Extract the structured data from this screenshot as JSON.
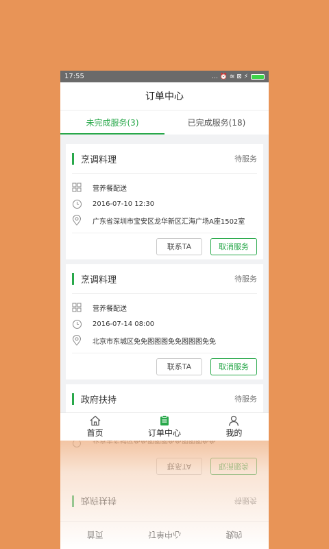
{
  "status_bar": {
    "time": "17:55",
    "icons": "… ⏰ ≋ ⊠ ⚡"
  },
  "header": {
    "title": "订单中心"
  },
  "tabs": [
    {
      "label": "未完成服务(3)",
      "active": true
    },
    {
      "label": "已完成服务(18)",
      "active": false
    }
  ],
  "orders": [
    {
      "name": "烹调料理",
      "status": "待服务",
      "service": "营养餐配送",
      "time": "2016-07-10 12:30",
      "address": "广东省深圳市宝安区龙华新区汇海广场A座1502室",
      "contact_label": "联系TA",
      "cancel_label": "取消服务"
    },
    {
      "name": "烹调料理",
      "status": "待服务",
      "service": "营养餐配送",
      "time": "2016-07-14 08:00",
      "address": "北京市东城区免免图图图免免图图图免免",
      "contact_label": "联系TA",
      "cancel_label": "取消服务"
    },
    {
      "name": "政府扶持",
      "status": "待服务"
    }
  ],
  "bottom_nav": [
    {
      "label": "首页",
      "icon": "home-icon",
      "active": false
    },
    {
      "label": "订单中心",
      "icon": "order-icon",
      "active": true
    },
    {
      "label": "我的",
      "icon": "profile-icon",
      "active": false
    }
  ],
  "colors": {
    "accent": "#28a84a",
    "background": "#E89457"
  }
}
